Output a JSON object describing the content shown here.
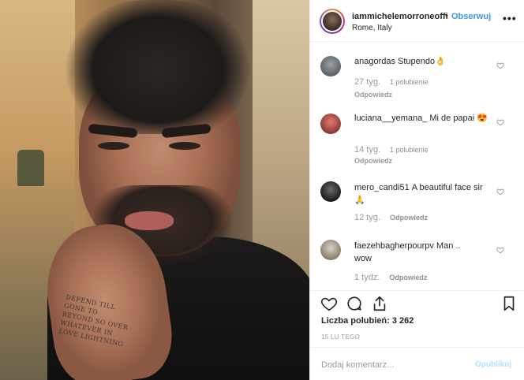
{
  "post": {
    "header": {
      "username": "iammichelemorroneoffi",
      "dot": "•",
      "follow_label": "Obserwuj",
      "location": "Rome, Italy",
      "more_label": "•••"
    },
    "photo": {
      "tattoo_lines": [
        "DEFEND TILL GONE TO",
        "BEYOND SO OVER",
        "WHATEVER IN",
        "LOVE LIGHTNING"
      ]
    },
    "comments": [
      {
        "user": "anagordas",
        "text": "Stupendo👌",
        "time": "27 tyg.",
        "likes": "1 polubienie",
        "reply": "Odpowiedz"
      },
      {
        "user": "luciana__yemana_",
        "text": "Mi de papai 😍",
        "time": "14 tyg.",
        "likes": "1 polubienie",
        "reply": "Odpowiedz"
      },
      {
        "user": "mero_candi51",
        "text": "A beautiful face sir🙏",
        "time": "12 tyg.",
        "likes": "",
        "reply": "Odpowiedz"
      },
      {
        "user": "faezehbagherpourpv",
        "text": "Man .. wow",
        "time": "1 tydz.",
        "likes": "",
        "reply": "Odpowiedz"
      }
    ],
    "likes_text": "Liczba polubień: 3 262",
    "date": "15 LU TEGO",
    "add_comment": {
      "placeholder": "Dodaj komentarz...",
      "publish_label": "Opublikuj"
    },
    "icons": {
      "like": "heart-icon",
      "comment": "comment-bubble-icon",
      "share": "share-icon",
      "save": "bookmark-icon"
    },
    "colors": {
      "accent": "#3897f0",
      "publish_disabled": "#b2dffc",
      "muted": "#999999",
      "text": "#262626"
    }
  }
}
